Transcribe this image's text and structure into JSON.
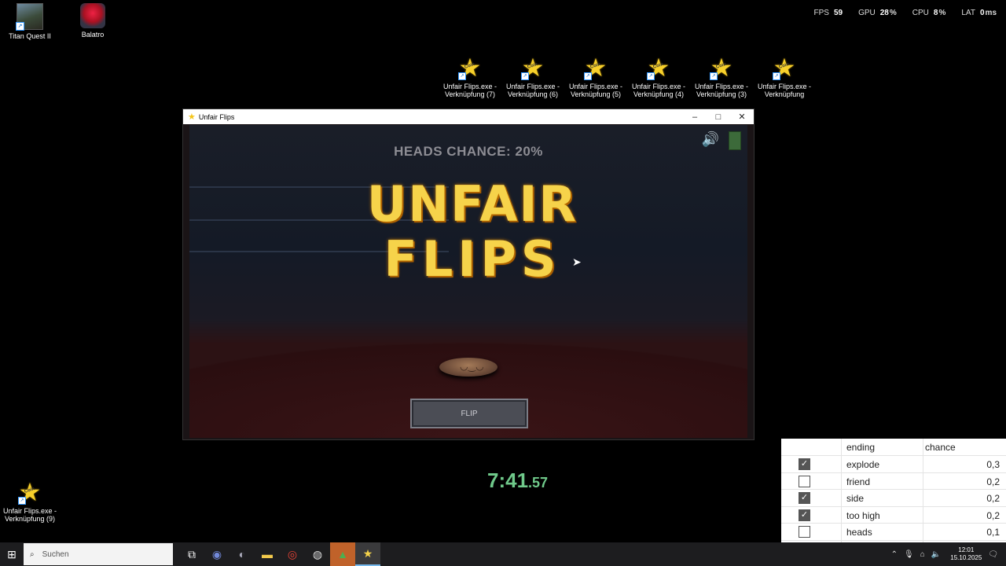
{
  "desktop_icons": [
    {
      "label": "Titan Quest II",
      "icon": "titan-quest-icon"
    },
    {
      "label": "Balatro",
      "icon": "balatro-icon"
    }
  ],
  "shortcuts_top": [
    {
      "line1": "Unfair Flips.exe -",
      "line2": "Verknüpfung (7)"
    },
    {
      "line1": "Unfair Flips.exe -",
      "line2": "Verknüpfung (6)"
    },
    {
      "line1": "Unfair Flips.exe -",
      "line2": "Verknüpfung (5)"
    },
    {
      "line1": "Unfair Flips.exe -",
      "line2": "Verknüpfung (4)"
    },
    {
      "line1": "Unfair Flips.exe -",
      "line2": "Verknüpfung (3)"
    },
    {
      "line1": "Unfair Flips.exe -",
      "line2": "Verknüpfung"
    }
  ],
  "shortcut_bottom": {
    "line1": "Unfair Flips.exe -",
    "line2": "Verknüpfung (9)"
  },
  "stats": {
    "fps_label": "FPS",
    "fps": "59",
    "gpu_label": "GPU",
    "gpu": "28",
    "gpu_unit": "%",
    "cpu_label": "CPU",
    "cpu": "8",
    "cpu_unit": "%",
    "lat_label": "LAT",
    "lat": "0",
    "lat_unit": "ms"
  },
  "window": {
    "title": "Unfair Flips",
    "minimize": "–",
    "maximize": "□",
    "close": "✕"
  },
  "game": {
    "heads_chance": "HEADS CHANCE: 20%",
    "logo_line1": "UNFAIR",
    "logo_line2": "FLIPS",
    "flip_label": "FLIP"
  },
  "timer": {
    "main": "7:41",
    "fraction": ".57"
  },
  "sheet": {
    "headers": [
      "ending",
      "chance"
    ],
    "rows": [
      {
        "checked": true,
        "ending": "explode",
        "chance": "0,3"
      },
      {
        "checked": false,
        "ending": "friend",
        "chance": "0,2"
      },
      {
        "checked": true,
        "ending": "side",
        "chance": "0,2"
      },
      {
        "checked": true,
        "ending": "too high",
        "chance": "0,2"
      },
      {
        "checked": false,
        "ending": "heads",
        "chance": "0,1"
      }
    ]
  },
  "taskbar": {
    "search_placeholder": "Suchen",
    "time": "12:01",
    "date": "15.10.2025"
  },
  "colors": {
    "accent": "#f6d34a",
    "timer": "#6fc98a"
  }
}
